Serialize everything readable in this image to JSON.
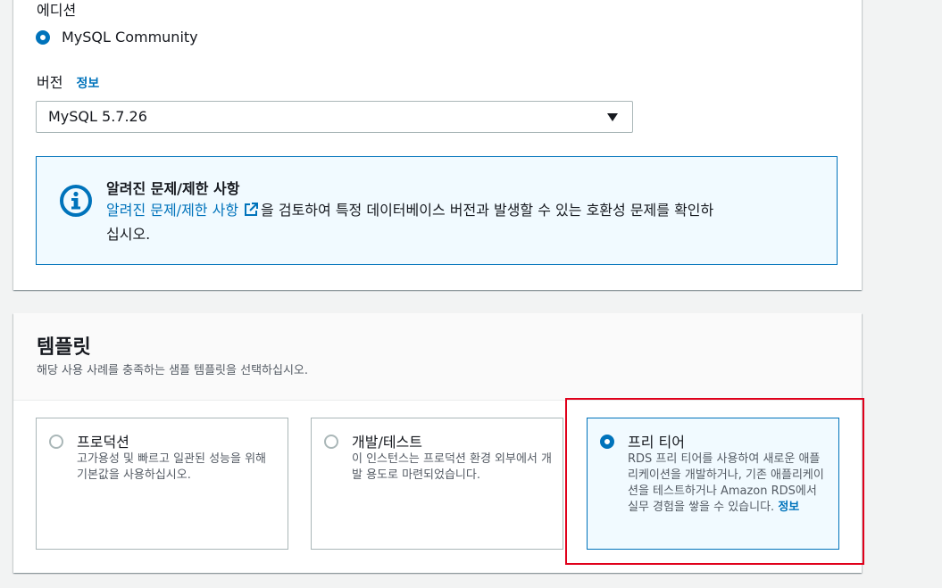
{
  "engine": {
    "edition_label": "에디션",
    "edition_option": "MySQL Community",
    "version_label": "버전",
    "version_info": "정보",
    "version_value": "MySQL 5.7.26",
    "alert": {
      "title": "알려진 문제/제한 사항",
      "link_text": "알려진 문제/제한 사항",
      "body_line1": "을 검토하여 특정 데이터베이스 버전과 발생할 수 있는 호환성 문제를 확인하",
      "body_line2": "십시오."
    }
  },
  "templates": {
    "title": "템플릿",
    "description": "해당 사용 사례를 충족하는 샘플 템플릿을 선택하십시오.",
    "options": [
      {
        "title": "프로덕션",
        "desc": "고가용성 및 빠르고 일관된 성능을 위해 기본값을 사용하십시오.",
        "selected": false
      },
      {
        "title": "개발/테스트",
        "desc": "이 인스턴스는 프로덕션 환경 외부에서 개발 용도로 마련되었습니다.",
        "selected": false
      },
      {
        "title": "프리 티어",
        "desc": "RDS 프리 티어를 사용하여 새로운 애플리케이션을 개발하거나, 기존 애플리케이션을 테스트하거나 Amazon RDS에서 실무 경험을 쌓을 수 있습니다.",
        "info": "정보",
        "selected": true
      }
    ]
  },
  "colors": {
    "accent": "#0073bb",
    "highlight": "#e0001b",
    "info_bg": "#f1faff"
  },
  "icons": [
    "info-circle-icon",
    "external-link-icon",
    "caret-down-icon"
  ]
}
